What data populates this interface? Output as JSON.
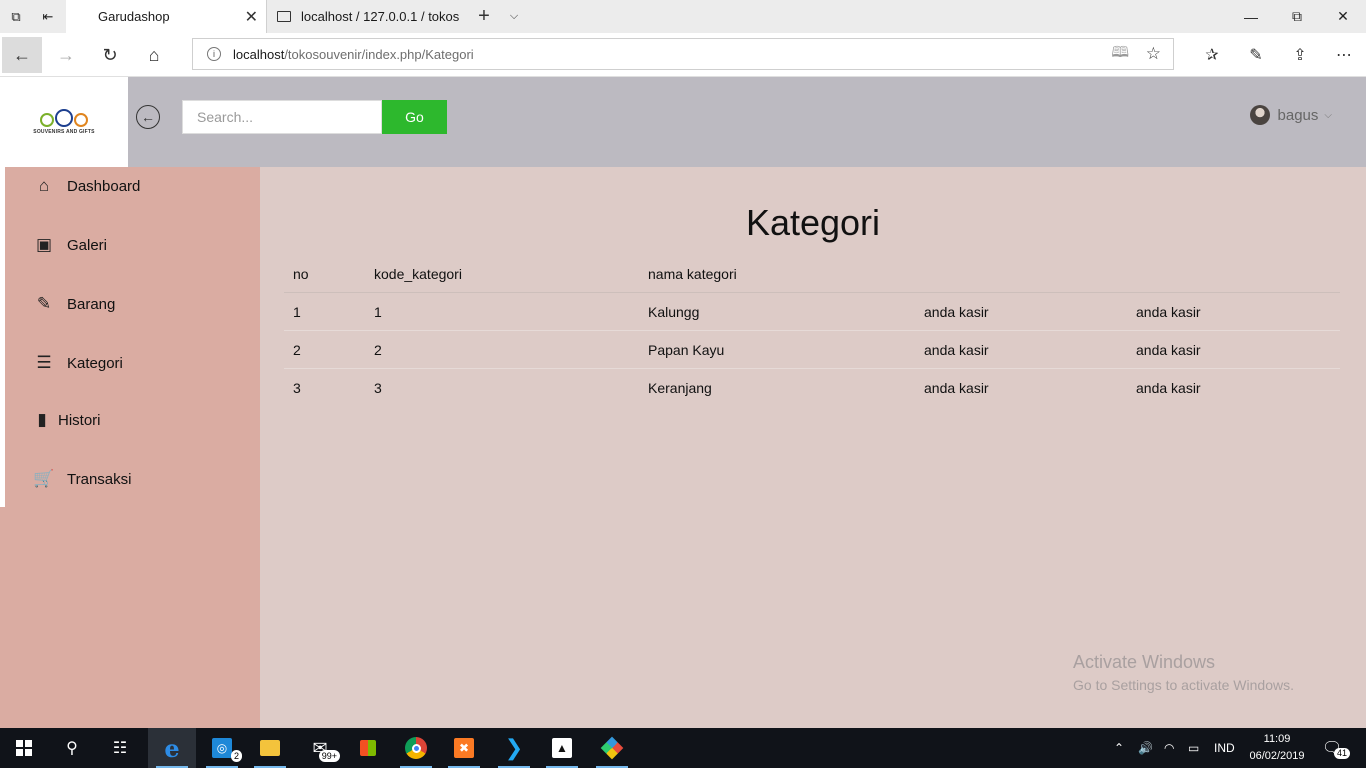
{
  "browser": {
    "tabs": [
      {
        "title": "Garudashop",
        "active": true
      },
      {
        "title": "localhost / 127.0.0.1 / tokos",
        "active": false
      }
    ],
    "url_host": "localhost",
    "url_path": "/tokosouvenir/index.php/Kategori"
  },
  "header": {
    "logo_text": "SOUVENIRS AND GIFTS",
    "search_placeholder": "Search...",
    "go_label": "Go",
    "user_name": "bagus"
  },
  "sidebar": {
    "items": [
      {
        "label": "Dashboard",
        "icon": "home-icon"
      },
      {
        "label": "Galeri",
        "icon": "image-icon"
      },
      {
        "label": "Barang",
        "icon": "pencil-icon"
      },
      {
        "label": "Kategori",
        "icon": "list-icon"
      },
      {
        "label": "Histori",
        "icon": "bookmark-icon"
      },
      {
        "label": "Transaksi",
        "icon": "cart-icon"
      }
    ]
  },
  "main": {
    "title": "Kategori",
    "table": {
      "headers": [
        "no",
        "kode_kategori",
        "nama kategori",
        "",
        ""
      ],
      "rows": [
        [
          "1",
          "1",
          "Kalungg",
          "anda kasir",
          "anda kasir"
        ],
        [
          "2",
          "2",
          "Papan Kayu",
          "anda kasir",
          "anda kasir"
        ],
        [
          "3",
          "3",
          "Keranjang",
          "anda kasir",
          "anda kasir"
        ]
      ]
    }
  },
  "watermark": {
    "line1": "Activate Windows",
    "line2": "Go to Settings to activate Windows."
  },
  "taskbar": {
    "mail_badge": "2",
    "store_badge": "99+",
    "language": "IND",
    "time": "11:09",
    "date": "06/02/2019",
    "notification_count": "41"
  },
  "colors": {
    "sidebar_bg": "#daaca2",
    "content_bg": "#ddcbc7",
    "topbar_bg": "#bcbac1",
    "go_button": "#2db82d"
  }
}
